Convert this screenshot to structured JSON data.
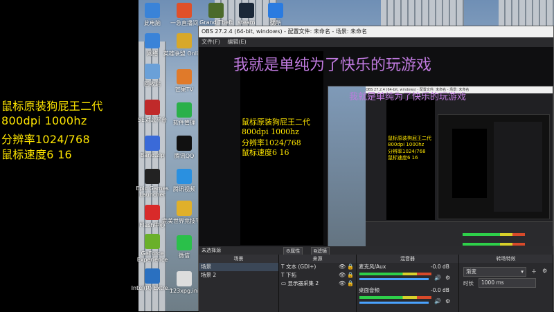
{
  "overlay": {
    "lines": [
      "鼠标原装狗屁王二代",
      "800dpi 1000hz",
      "分辨率1024/768",
      "鼠标速度6   16"
    ]
  },
  "banner": {
    "text": "我就是单纯为了快乐的玩游戏"
  },
  "desktop": {
    "icons": [
      {
        "label": "此电脑",
        "color": "#3a83d8"
      },
      {
        "label": "一急直播间",
        "color": "#e0502a"
      },
      {
        "label": "Grand Theft",
        "color": "#4b6a2a"
      },
      {
        "label": "steam",
        "color": "#1b2838"
      },
      {
        "label": "优酷",
        "color": "#2a7be0"
      },
      {
        "label": "网络",
        "color": "#3a83d8"
      },
      {
        "label": "英雄联盟 Online",
        "color": "#d8a82a"
      },
      {
        "label": "回收站",
        "color": "#6aa0d8"
      },
      {
        "label": "芒果TV",
        "color": "#e07a2a"
      },
      {
        "label": "5E对战平台",
        "color": "#c02a2a"
      },
      {
        "label": "软件管理",
        "color": "#2ab04a"
      },
      {
        "label": "Band.zip",
        "color": "#3a6ad8"
      },
      {
        "label": "腾讯QQ",
        "color": "#111111"
      },
      {
        "label": "Epic Games Launcher",
        "color": "#222222"
      },
      {
        "label": "腾讯视频",
        "color": "#2a90e0"
      },
      {
        "label": "Flash中心",
        "color": "#d82a2a"
      },
      {
        "label": "完美世界竞技平台",
        "color": "#e0b02a"
      },
      {
        "label": "GeForce Experience",
        "color": "#6ab02a"
      },
      {
        "label": "微信",
        "color": "#2ac04a"
      },
      {
        "label": "Intel(R) Extre...",
        "color": "#2a70c0"
      },
      {
        "label": "123xpg.ini",
        "color": "#dddddd"
      }
    ]
  },
  "obs": {
    "title": "OBS 27.2.4 (64-bit, windows) - 配置文件: 未命名 - 场景: 未命名",
    "menu": [
      "文件(F)",
      "编辑(E)"
    ],
    "canvas_lines": [
      "鼠标原装狗屁王二代",
      "800dpi 1000hz",
      "分辨率1024/768",
      "鼠标速度6   16"
    ],
    "inner_title": "OBS 27.2.4 (64-bit, windows) - 配置文件: 未命名 - 场景: 未命名",
    "status": "未选择源",
    "properties_btn": "属性",
    "filters_btn": "滤镜",
    "docks": {
      "scenes": {
        "title": "场景",
        "items": [
          "场景",
          "场景 2"
        ]
      },
      "sources": {
        "title": "来源",
        "items": [
          "文本 (GDI+)",
          "下拓",
          "显示器采集 2"
        ]
      },
      "mixer": {
        "title": "混音器",
        "channels": [
          {
            "name": "麦克风/Aux",
            "level": "-0.0 dB"
          },
          {
            "name": "桌面音频",
            "level": "-0.0 dB"
          }
        ]
      },
      "transitions": {
        "title": "转场特效",
        "selected": "渐变",
        "duration_label": "时长",
        "duration_value": "1000 ms"
      }
    }
  }
}
